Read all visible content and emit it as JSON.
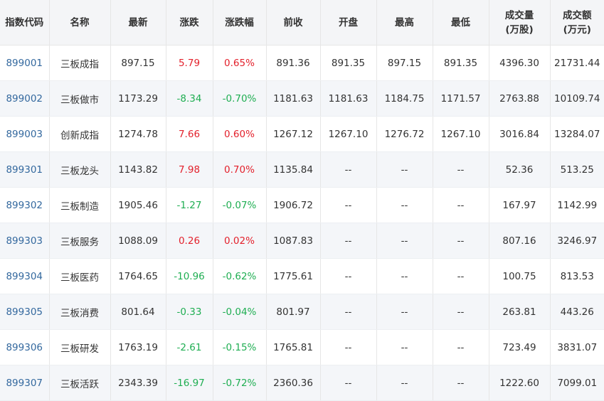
{
  "colors": {
    "up": "#e3212c",
    "down": "#1fae52",
    "code": "#33689e",
    "header_bg": "#f4f5f7",
    "stripe_bg": "#f4f6f9"
  },
  "table": {
    "headers": [
      {
        "label": "指数代码"
      },
      {
        "label": "名称"
      },
      {
        "label": "最新"
      },
      {
        "label": "涨跌"
      },
      {
        "label": "涨跌幅"
      },
      {
        "label": "前收"
      },
      {
        "label": "开盘"
      },
      {
        "label": "最高"
      },
      {
        "label": "最低"
      },
      {
        "label": "成交量",
        "unit": "(万股)"
      },
      {
        "label": "成交额",
        "unit": "(万元)"
      }
    ],
    "rows": [
      {
        "code": "899001",
        "name": "三板成指",
        "latest": "897.15",
        "change": "5.79",
        "pct": "0.65%",
        "prev": "891.36",
        "open": "891.35",
        "high": "897.15",
        "low": "891.35",
        "vol": "4396.30",
        "amt": "21731.44",
        "dir": "up"
      },
      {
        "code": "899002",
        "name": "三板做市",
        "latest": "1173.29",
        "change": "-8.34",
        "pct": "-0.70%",
        "prev": "1181.63",
        "open": "1181.63",
        "high": "1184.75",
        "low": "1171.57",
        "vol": "2763.88",
        "amt": "10109.74",
        "dir": "down"
      },
      {
        "code": "899003",
        "name": "创新成指",
        "latest": "1274.78",
        "change": "7.66",
        "pct": "0.60%",
        "prev": "1267.12",
        "open": "1267.10",
        "high": "1276.72",
        "low": "1267.10",
        "vol": "3016.84",
        "amt": "13284.07",
        "dir": "up"
      },
      {
        "code": "899301",
        "name": "三板龙头",
        "latest": "1143.82",
        "change": "7.98",
        "pct": "0.70%",
        "prev": "1135.84",
        "open": "--",
        "high": "--",
        "low": "--",
        "vol": "52.36",
        "amt": "513.25",
        "dir": "up"
      },
      {
        "code": "899302",
        "name": "三板制造",
        "latest": "1905.46",
        "change": "-1.27",
        "pct": "-0.07%",
        "prev": "1906.72",
        "open": "--",
        "high": "--",
        "low": "--",
        "vol": "167.97",
        "amt": "1142.99",
        "dir": "down"
      },
      {
        "code": "899303",
        "name": "三板服务",
        "latest": "1088.09",
        "change": "0.26",
        "pct": "0.02%",
        "prev": "1087.83",
        "open": "--",
        "high": "--",
        "low": "--",
        "vol": "807.16",
        "amt": "3246.97",
        "dir": "up"
      },
      {
        "code": "899304",
        "name": "三板医药",
        "latest": "1764.65",
        "change": "-10.96",
        "pct": "-0.62%",
        "prev": "1775.61",
        "open": "--",
        "high": "--",
        "low": "--",
        "vol": "100.75",
        "amt": "813.53",
        "dir": "down"
      },
      {
        "code": "899305",
        "name": "三板消费",
        "latest": "801.64",
        "change": "-0.33",
        "pct": "-0.04%",
        "prev": "801.97",
        "open": "--",
        "high": "--",
        "low": "--",
        "vol": "263.81",
        "amt": "443.26",
        "dir": "down"
      },
      {
        "code": "899306",
        "name": "三板研发",
        "latest": "1763.19",
        "change": "-2.61",
        "pct": "-0.15%",
        "prev": "1765.81",
        "open": "--",
        "high": "--",
        "low": "--",
        "vol": "723.49",
        "amt": "3831.07",
        "dir": "down"
      },
      {
        "code": "899307",
        "name": "三板活跃",
        "latest": "2343.39",
        "change": "-16.97",
        "pct": "-0.72%",
        "prev": "2360.36",
        "open": "--",
        "high": "--",
        "low": "--",
        "vol": "1222.60",
        "amt": "7099.01",
        "dir": "down"
      }
    ]
  }
}
